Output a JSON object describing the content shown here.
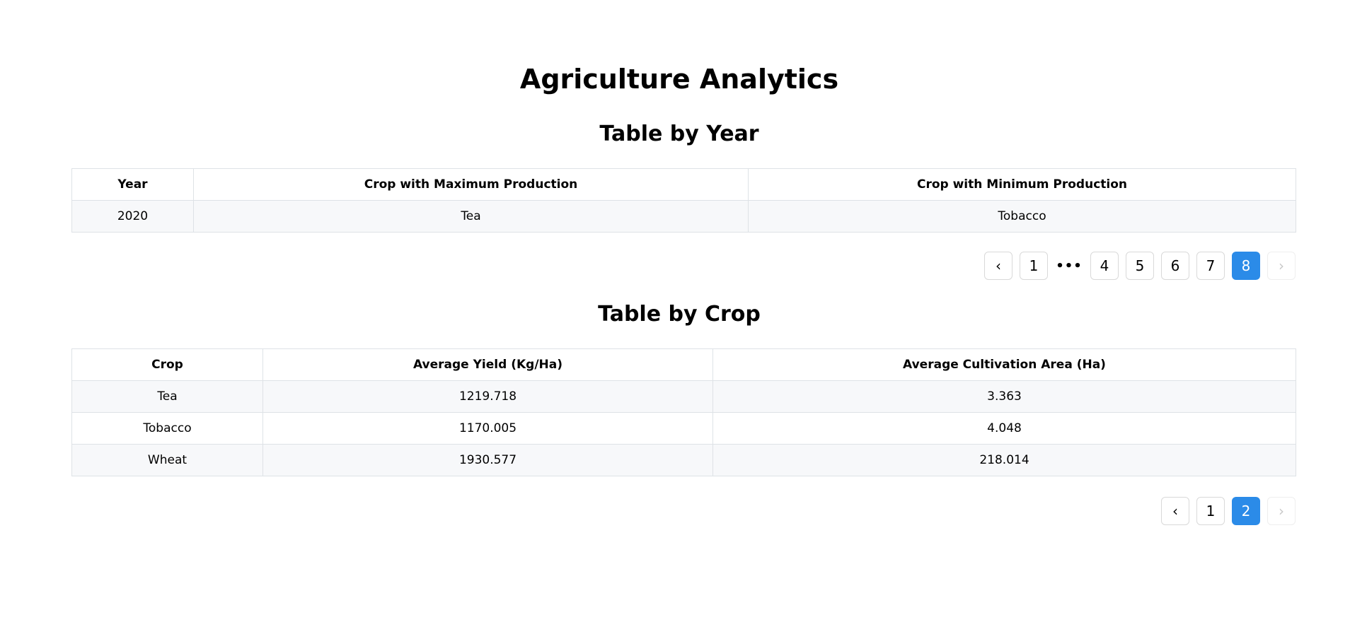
{
  "page": {
    "title": "Agriculture Analytics"
  },
  "year_section": {
    "title": "Table by Year",
    "columns": [
      "Year",
      "Crop with Maximum Production",
      "Crop with Minimum Production"
    ],
    "rows": [
      [
        "2020",
        "Tea",
        "Tobacco"
      ]
    ],
    "pagination": {
      "prev_icon": "chevron-left-icon",
      "next_icon": "chevron-right-icon",
      "prev_glyph": "‹",
      "next_glyph": "›",
      "items": [
        "1",
        "•••",
        "4",
        "5",
        "6",
        "7",
        "8"
      ],
      "current": "8",
      "next_disabled": true
    }
  },
  "crop_section": {
    "title": "Table by Crop",
    "columns": [
      "Crop",
      "Average Yield (Kg/Ha)",
      "Average Cultivation Area (Ha)"
    ],
    "rows": [
      [
        "Tea",
        "1219.718",
        "3.363"
      ],
      [
        "Tobacco",
        "1170.005",
        "4.048"
      ],
      [
        "Wheat",
        "1930.577",
        "218.014"
      ]
    ],
    "pagination": {
      "prev_icon": "chevron-left-icon",
      "next_icon": "chevron-right-icon",
      "prev_glyph": "‹",
      "next_glyph": "›",
      "items": [
        "1",
        "2"
      ],
      "current": "2",
      "next_disabled": true
    }
  },
  "colors": {
    "accent": "#2b8be8",
    "border": "#dee2e6",
    "row_stripe": "#f7f8fa"
  }
}
